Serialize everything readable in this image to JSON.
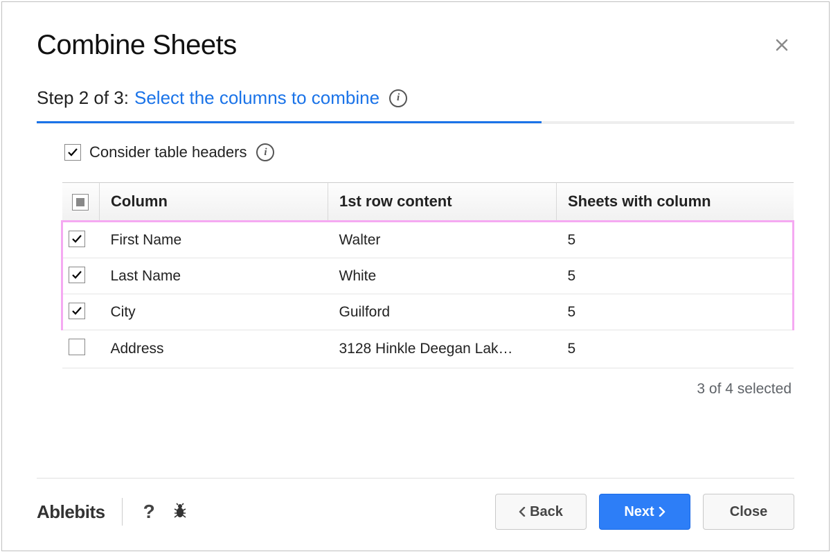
{
  "header": {
    "title": "Combine Sheets"
  },
  "step": {
    "prefix": "Step 2 of 3:",
    "action": "Select the columns to combine"
  },
  "options": {
    "consider_headers_label": "Consider table headers"
  },
  "table": {
    "headers": {
      "column": "Column",
      "first_row": "1st row content",
      "sheets_with": "Sheets with column"
    },
    "rows": [
      {
        "checked": true,
        "column": "First Name",
        "first_row": "Walter",
        "sheets": "5"
      },
      {
        "checked": true,
        "column": "Last Name",
        "first_row": "White",
        "sheets": "5"
      },
      {
        "checked": true,
        "column": "City",
        "first_row": "Guilford",
        "sheets": "5"
      },
      {
        "checked": false,
        "column": "Address",
        "first_row": "3128 Hinkle Deegan Lak…",
        "sheets": "5"
      }
    ]
  },
  "selection_status": "3 of 4 selected",
  "footer": {
    "brand": "Ablebits",
    "back": "Back",
    "next": "Next",
    "close": "Close"
  }
}
